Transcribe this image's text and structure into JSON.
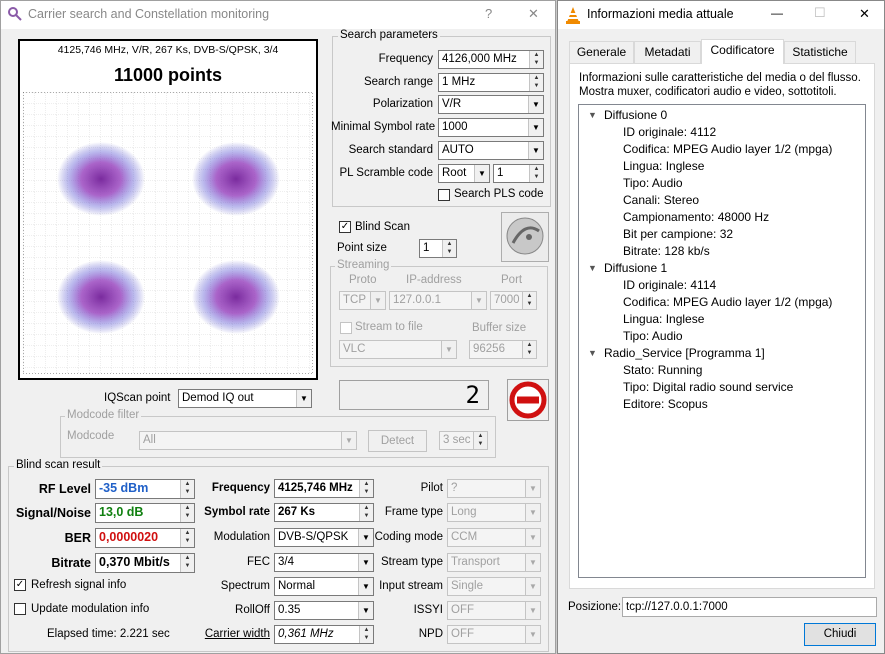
{
  "left": {
    "title": "Carrier search and Constellation monitoring",
    "help": "?",
    "close": "✕",
    "constellation": {
      "info": "4125,746 MHz, V/R, 267 Ks, DVB-S/QPSK, 3/4",
      "points": "11000 points"
    },
    "search_params": {
      "title": "Search parameters",
      "frequency": {
        "label": "Frequency",
        "value": "4126,000 MHz"
      },
      "range": {
        "label": "Search range",
        "value": "1 MHz"
      },
      "polarization": {
        "label": "Polarization",
        "value": "V/R"
      },
      "min_sr": {
        "label": "Minimal Symbol rate",
        "value": "1000"
      },
      "standard": {
        "label": "Search standard",
        "value": "AUTO"
      },
      "pls": {
        "label": "PL Scramble code",
        "mode": "Root",
        "value": "1"
      },
      "search_pls": "Search PLS code"
    },
    "blind_scan": "Blind Scan",
    "point_size": {
      "label": "Point size",
      "value": "1"
    },
    "streaming": {
      "title": "Streaming",
      "proto_label": "Proto",
      "ip_label": "IP-address",
      "port_label": "Port",
      "proto": "TCP",
      "ip": "127.0.0.1",
      "port": "7000",
      "stream_to_file": "Stream to file",
      "buffer_label": "Buffer size",
      "player": "VLC",
      "buffer": "96256"
    },
    "counter": "2",
    "iq": {
      "label": "IQScan point",
      "value": "Demod IQ out"
    },
    "modcode": {
      "title": "Modcode filter",
      "label": "Modcode",
      "value": "All",
      "detect": "Detect",
      "timeout": "3 sec"
    },
    "result": {
      "title": "Blind scan result",
      "rf": {
        "label": "RF Level",
        "value": "-35 dBm"
      },
      "snr": {
        "label": "Signal/Noise",
        "value": "13,0 dB"
      },
      "ber": {
        "label": "BER",
        "value": "0,0000020"
      },
      "bitrate": {
        "label": "Bitrate",
        "value": "0,370 Mbit/s"
      },
      "refresh": "Refresh signal info",
      "update_mod": "Update modulation info",
      "elapsed": "Elapsed time: 2.221 sec",
      "freq": {
        "label": "Frequency",
        "value": "4125,746 MHz"
      },
      "sr": {
        "label": "Symbol rate",
        "value": "267 Ks"
      },
      "modulation": {
        "label": "Modulation",
        "value": "DVB-S/QPSK"
      },
      "fec": {
        "label": "FEC",
        "value": "3/4"
      },
      "spectrum": {
        "label": "Spectrum",
        "value": "Normal"
      },
      "rolloff": {
        "label": "RollOff",
        "value": "0.35"
      },
      "carrier_width": {
        "label": "Carrier width",
        "value": "0,361 MHz"
      },
      "pilot": {
        "label": "Pilot",
        "value": "?"
      },
      "frame": {
        "label": "Frame type",
        "value": "Long"
      },
      "coding": {
        "label": "Coding mode",
        "value": "CCM"
      },
      "stream_type": {
        "label": "Stream type",
        "value": "Transport"
      },
      "input_stream": {
        "label": "Input stream",
        "value": "Single"
      },
      "issyi": {
        "label": "ISSYI",
        "value": "OFF"
      },
      "npd": {
        "label": "NPD",
        "value": "OFF"
      }
    }
  },
  "right": {
    "title": "Informazioni media attuale",
    "min": "—",
    "max": "☐",
    "close": "✕",
    "tabs": [
      "Generale",
      "Metadati",
      "Codificatore",
      "Statistiche"
    ],
    "desc1": "Informazioni sulle caratteristiche del media o del flusso.",
    "desc2": "Mostra muxer, codificatori audio e video, sottotitoli.",
    "tree": [
      {
        "head": "Diffusione 0",
        "items": [
          "ID originale: 4112",
          "Codifica: MPEG Audio layer 1/2 (mpga)",
          "Lingua: Inglese",
          "Tipo: Audio",
          "Canali: Stereo",
          "Campionamento: 48000 Hz",
          "Bit per campione: 32",
          "Bitrate: 128 kb/s"
        ]
      },
      {
        "head": "Diffusione 1",
        "items": [
          "ID originale: 4114",
          "Codifica: MPEG Audio layer 1/2 (mpga)",
          "Lingua: Inglese",
          "Tipo: Audio"
        ]
      },
      {
        "head": "Radio_Service [Programma 1]",
        "items": [
          "Stato: Running",
          "Tipo: Digital radio sound service",
          "Editore: Scopus"
        ]
      }
    ],
    "position_label": "Posizione:",
    "position": "tcp://127.0.0.1:7000",
    "close_btn": "Chiudi"
  }
}
